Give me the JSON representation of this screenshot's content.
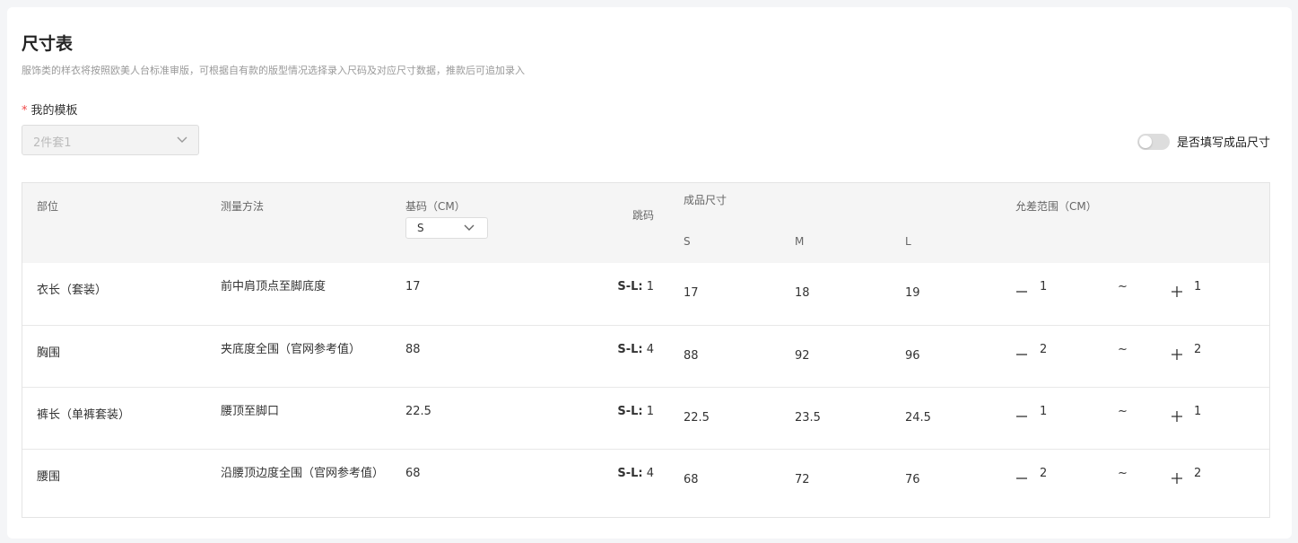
{
  "page": {
    "title": "尺寸表",
    "subtitle": "服饰类的样衣将按照欧美人台标准审版，可根据自有款的版型情况选择录入尺码及对应尺寸数据，推款后可追加录入",
    "template_label": "我的模板",
    "template_required_mark": "*",
    "template_value": "2件套1",
    "toggle_label": "是否填写成品尺寸",
    "toggle_on": false
  },
  "table": {
    "headers": {
      "part": "部位",
      "method": "测量方法",
      "base": "基码（CM）",
      "jump": "跳码",
      "finished": "成品尺寸",
      "tolerance": "允差范围（CM）"
    },
    "base_size_selected": "S",
    "size_headers": [
      "S",
      "M",
      "L"
    ],
    "rows": [
      {
        "part": "衣长（套装）",
        "method": "前中肩顶点至脚底度",
        "base": "17",
        "jump_label": "S-L:",
        "jump_value": "1",
        "sizes": [
          "17",
          "18",
          "19"
        ],
        "minus": "1",
        "tilde": "~",
        "plus": "1"
      },
      {
        "part": "胸围",
        "method": "夹底度全围（官网参考值）",
        "base": "88",
        "jump_label": "S-L:",
        "jump_value": "4",
        "sizes": [
          "88",
          "92",
          "96"
        ],
        "minus": "2",
        "tilde": "~",
        "plus": "2"
      },
      {
        "part": "裤长（单裤套装）",
        "method": "腰顶至脚口",
        "base": "22.5",
        "jump_label": "S-L:",
        "jump_value": "1",
        "sizes": [
          "22.5",
          "23.5",
          "24.5"
        ],
        "minus": "1",
        "tilde": "~",
        "plus": "1"
      },
      {
        "part": "腰围",
        "method": "沿腰顶边度全围（官网参考值）",
        "base": "68",
        "jump_label": "S-L:",
        "jump_value": "4",
        "sizes": [
          "68",
          "72",
          "76"
        ],
        "minus": "2",
        "tilde": "~",
        "plus": "2"
      }
    ]
  },
  "icons": {
    "dropdown": "chevron-down-icon",
    "minus": "minus-icon",
    "plus": "plus-icon"
  },
  "colors": {
    "required": "#f04848",
    "header_bg": "#f5f5f5",
    "toggle_off": "#dddddd"
  }
}
